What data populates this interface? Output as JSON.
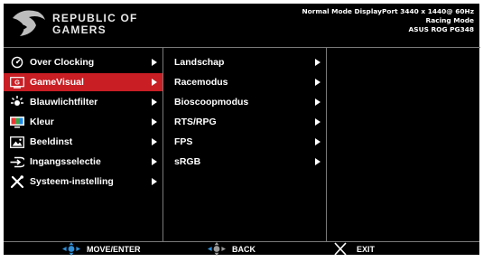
{
  "brand": {
    "line1": "REPUBLIC OF",
    "line2": "GAMERS"
  },
  "status": {
    "line1": "Normal Mode DisplayPort 3440 x 1440@ 60Hz",
    "line2": "Racing Mode",
    "line3": "ASUS ROG PG348"
  },
  "menu": {
    "items": [
      {
        "label": "Over Clocking",
        "icon": "overclock-icon"
      },
      {
        "label": "GameVisual",
        "icon": "gamevisual-icon",
        "selected": true
      },
      {
        "label": "Blauwlichtfilter",
        "icon": "bluelight-icon"
      },
      {
        "label": "Kleur",
        "icon": "color-icon"
      },
      {
        "label": "Beeldinst",
        "icon": "image-icon"
      },
      {
        "label": "Ingangsselectie",
        "icon": "input-icon"
      },
      {
        "label": "Systeem-instelling",
        "icon": "system-icon"
      }
    ]
  },
  "submenu": {
    "items": [
      {
        "label": "Landschap"
      },
      {
        "label": "Racemodus"
      },
      {
        "label": "Bioscoopmodus"
      },
      {
        "label": "RTS/RPG"
      },
      {
        "label": "FPS"
      },
      {
        "label": "sRGB"
      }
    ]
  },
  "footer": {
    "move_enter": "MOVE/ENTER",
    "back": "BACK",
    "exit": "EXIT"
  },
  "colors": {
    "accent": "#c81e24",
    "joystick": "#2f8fd8",
    "divider": "#7a7a7a"
  }
}
